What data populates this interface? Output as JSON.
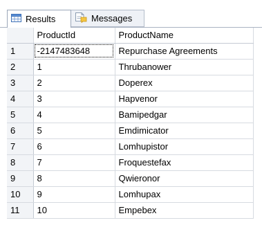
{
  "tabs": [
    {
      "label": "Results",
      "icon": "grid-icon",
      "active": true
    },
    {
      "label": "Messages",
      "icon": "messages-icon",
      "active": false
    }
  ],
  "grid": {
    "columns": [
      "ProductId",
      "ProductName"
    ],
    "rows": [
      {
        "row_number": "1",
        "product_id": "-2147483648",
        "product_name": "Repurchase Agreements"
      },
      {
        "row_number": "2",
        "product_id": "1",
        "product_name": "Thrubanower"
      },
      {
        "row_number": "3",
        "product_id": "2",
        "product_name": "Doperex"
      },
      {
        "row_number": "4",
        "product_id": "3",
        "product_name": "Hapvenor"
      },
      {
        "row_number": "5",
        "product_id": "4",
        "product_name": "Bamipedgar"
      },
      {
        "row_number": "6",
        "product_id": "5",
        "product_name": "Emdimicator"
      },
      {
        "row_number": "7",
        "product_id": "6",
        "product_name": "Lomhupistor"
      },
      {
        "row_number": "8",
        "product_id": "7",
        "product_name": "Froquestefax"
      },
      {
        "row_number": "9",
        "product_id": "8",
        "product_name": "Qwieronor"
      },
      {
        "row_number": "10",
        "product_id": "9",
        "product_name": "Lomhupax"
      },
      {
        "row_number": "11",
        "product_id": "10",
        "product_name": "Empebex"
      }
    ]
  }
}
